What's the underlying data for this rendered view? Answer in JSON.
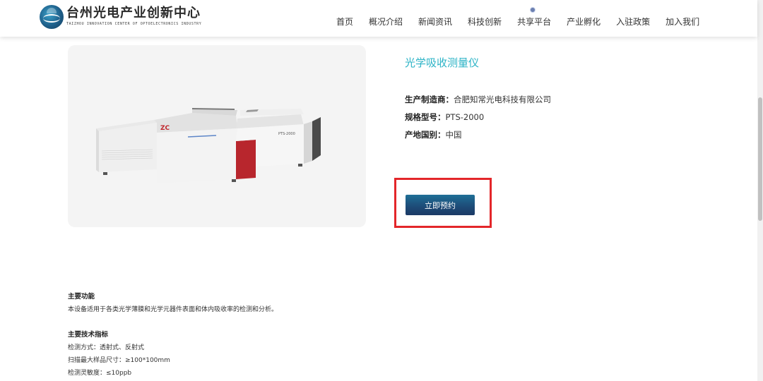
{
  "header": {
    "logo_cn": "台州光电产业创新中心",
    "logo_en": "TAIZHOU INNOVATION CENTER OF OPTOELECTRONICS INDUSTRY",
    "nav": [
      {
        "label": "首页"
      },
      {
        "label": "概况介绍"
      },
      {
        "label": "新闻资讯"
      },
      {
        "label": "科技创新"
      },
      {
        "label": "共享平台",
        "icon": "globe-icon"
      },
      {
        "label": "产业孵化"
      },
      {
        "label": "入驻政策"
      },
      {
        "label": "加入我们"
      }
    ]
  },
  "product": {
    "image_brand": "ZC",
    "image_model": "PTS-2000",
    "title": "光学吸收测量仪",
    "specs": [
      {
        "label": "生产制造商：",
        "value": "合肥知常光电科技有限公司"
      },
      {
        "label": "规格型号：",
        "value": "PTS-2000"
      },
      {
        "label": "产地国别：",
        "value": "中国"
      }
    ],
    "reserve_label": "立即预约"
  },
  "details": {
    "function_title": "主要功能",
    "function_text": "本设备适用于各类光学薄膜和光学元器件表面和体内吸收率的检测和分析。",
    "spec_title": "主要技术指标",
    "spec_lines": [
      "检测方式：透射式、反射式",
      "扫描最大样品尺寸：≥100*100mm",
      "检测灵敏度：≤10ppb"
    ]
  },
  "colors": {
    "title_accent": "#2bb3c6",
    "button": "#1d4a76",
    "highlight": "#e3262a"
  }
}
